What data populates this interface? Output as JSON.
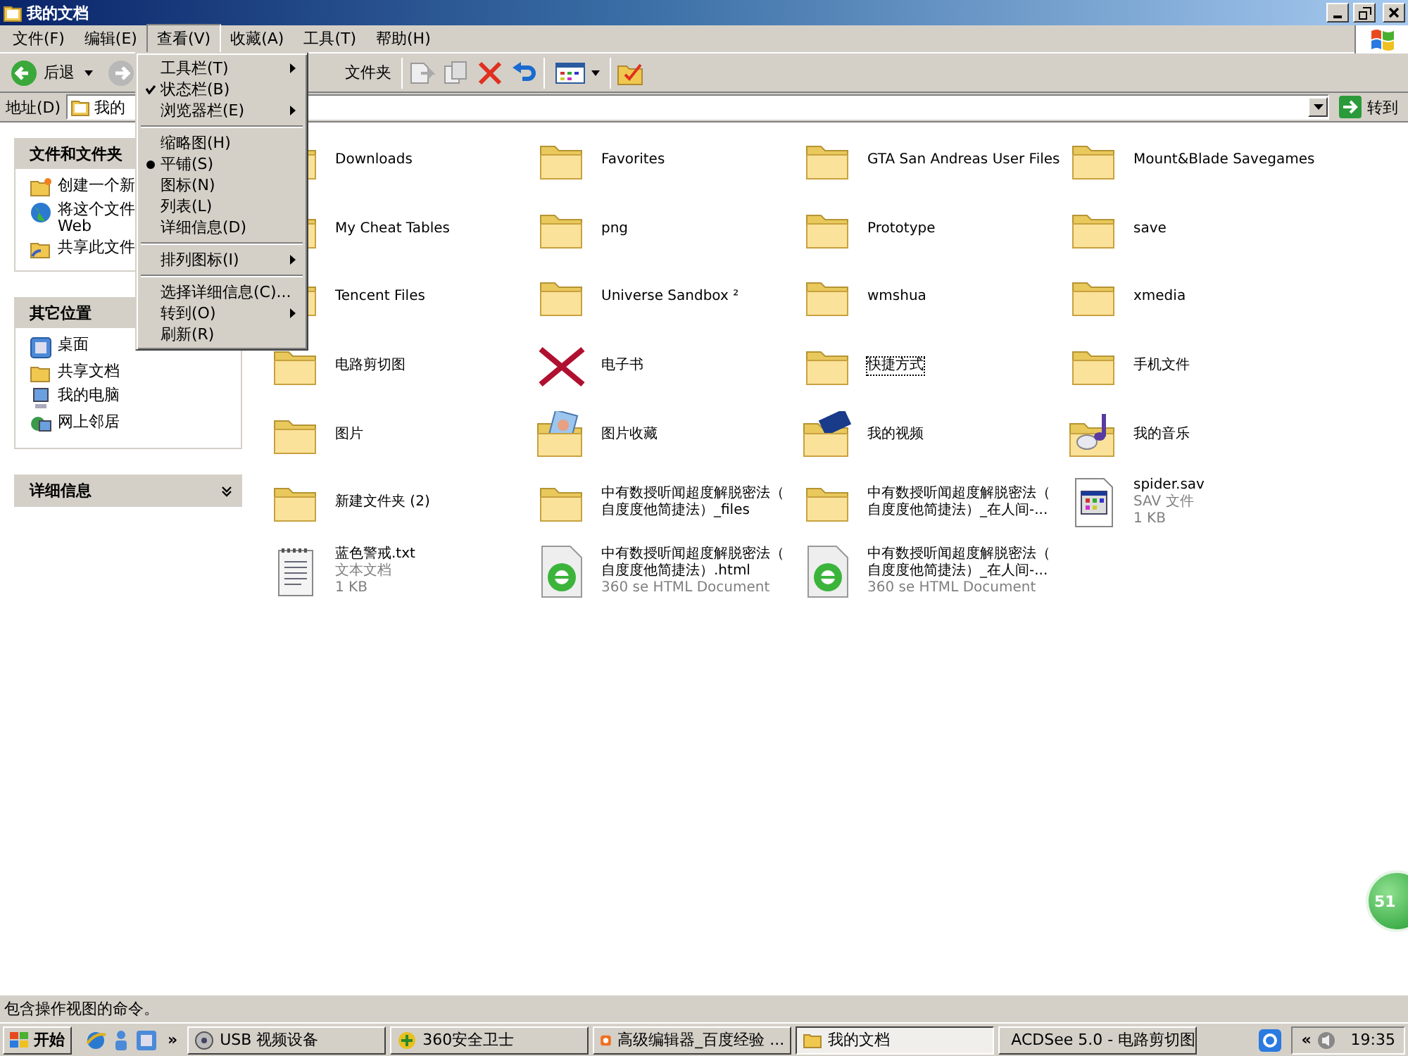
{
  "window": {
    "title": "我的文档"
  },
  "menu_bar": [
    {
      "label": "文件(F)",
      "selected": false
    },
    {
      "label": "编辑(E)",
      "selected": false
    },
    {
      "label": "查看(V)",
      "selected": true
    },
    {
      "label": "收藏(A)",
      "selected": false
    },
    {
      "label": "工具(T)",
      "selected": false
    },
    {
      "label": "帮助(H)",
      "selected": false
    }
  ],
  "toolbar": {
    "back": "后退",
    "folders": "文件夹"
  },
  "address_bar": {
    "label": "地址(D)",
    "value": "我的",
    "go": "转到"
  },
  "task_panes": [
    {
      "title": "文件和文件夹",
      "expanded": true,
      "items": [
        {
          "kind": "new-folder",
          "lines": [
            "创建一个新"
          ]
        },
        {
          "kind": "globe",
          "lines": [
            "将这个文件",
            "Web"
          ]
        },
        {
          "kind": "share",
          "lines": [
            "共享此文件"
          ]
        }
      ]
    },
    {
      "title": "其它位置",
      "expanded": true,
      "items": [
        {
          "kind": "desktop",
          "lines": [
            "桌面"
          ]
        },
        {
          "kind": "folder",
          "lines": [
            "共享文档"
          ]
        },
        {
          "kind": "computer",
          "lines": [
            "我的电脑"
          ]
        },
        {
          "kind": "network",
          "lines": [
            "网上邻居"
          ]
        }
      ]
    },
    {
      "title": "详细信息",
      "expanded": false
    }
  ],
  "view_menu": {
    "groups": [
      [
        {
          "kind": "submenu",
          "label": "工具栏(T)"
        },
        {
          "kind": "check",
          "label": "状态栏(B)",
          "checked": true
        },
        {
          "kind": "submenu",
          "label": "浏览器栏(E)"
        }
      ],
      [
        {
          "kind": "radio",
          "label": "缩略图(H)",
          "selected": false
        },
        {
          "kind": "radio",
          "label": "平铺(S)",
          "selected": true
        },
        {
          "kind": "radio",
          "label": "图标(N)",
          "selected": false
        },
        {
          "kind": "radio",
          "label": "列表(L)",
          "selected": false
        },
        {
          "kind": "radio",
          "label": "详细信息(D)",
          "selected": false
        }
      ],
      [
        {
          "kind": "submenu",
          "label": "排列图标(I)"
        }
      ],
      [
        {
          "kind": "command",
          "label": "选择详细信息(C)..."
        },
        {
          "kind": "submenu",
          "label": "转到(O)"
        },
        {
          "kind": "command",
          "label": "刷新(R)"
        }
      ]
    ]
  },
  "files": [
    {
      "kind": "folder",
      "lines": [
        "Downloads"
      ],
      "focused": false
    },
    {
      "kind": "folder",
      "lines": [
        "Favorites"
      ],
      "focused": false
    },
    {
      "kind": "folder",
      "lines": [
        "GTA San Andreas User Files"
      ],
      "focused": false
    },
    {
      "kind": "folder",
      "lines": [
        "Mount&Blade Savegames"
      ],
      "focused": false
    },
    {
      "kind": "folder",
      "lines": [
        "My Cheat Tables"
      ],
      "focused": false
    },
    {
      "kind": "folder",
      "lines": [
        "png"
      ],
      "focused": false
    },
    {
      "kind": "folder",
      "lines": [
        "Prototype"
      ],
      "focused": false
    },
    {
      "kind": "folder",
      "lines": [
        "save"
      ],
      "focused": false
    },
    {
      "kind": "folder",
      "lines": [
        "Tencent Files"
      ],
      "focused": false
    },
    {
      "kind": "folder",
      "lines": [
        "Universe Sandbox ²"
      ],
      "focused": false
    },
    {
      "kind": "folder",
      "lines": [
        "wmshua"
      ],
      "focused": false
    },
    {
      "kind": "folder",
      "lines": [
        "xmedia"
      ],
      "focused": false
    },
    {
      "kind": "folder",
      "lines": [
        "电路剪切图"
      ],
      "focused": false
    },
    {
      "kind": "cross",
      "lines": [
        "电子书"
      ],
      "focused": false
    },
    {
      "kind": "folder",
      "lines": [
        "快捷方式"
      ],
      "focused": true
    },
    {
      "kind": "folder",
      "lines": [
        "手机文件"
      ],
      "focused": false
    },
    {
      "kind": "folder",
      "lines": [
        "图片"
      ],
      "focused": false
    },
    {
      "kind": "pictures",
      "lines": [
        "图片收藏"
      ],
      "focused": false
    },
    {
      "kind": "video",
      "lines": [
        "我的视频"
      ],
      "focused": false
    },
    {
      "kind": "music",
      "lines": [
        "我的音乐"
      ],
      "focused": false
    },
    {
      "kind": "folder",
      "lines": [
        "新建文件夹 (2)"
      ],
      "focused": false
    },
    {
      "kind": "folder",
      "lines": [
        "中有数授听闻超度解脱密法（",
        "自度度他简捷法）_files"
      ],
      "focused": false
    },
    {
      "kind": "folder",
      "lines": [
        "中有数授听闻超度解脱密法（",
        "自度度他简捷法）_在人间-..."
      ],
      "focused": false
    },
    {
      "kind": "sav",
      "lines": [
        "spider.sav"
      ],
      "type": "SAV 文件",
      "size": "1 KB",
      "focused": false
    },
    {
      "kind": "text",
      "lines": [
        "蓝色警戒.txt"
      ],
      "type": "文本文档",
      "size": "1 KB",
      "focused": false
    },
    {
      "kind": "html",
      "lines": [
        "中有数授听闻超度解脱密法（",
        "自度度他简捷法）.html"
      ],
      "type": "360 se HTML Document",
      "focused": false
    },
    {
      "kind": "html",
      "lines": [
        "中有数授听闻超度解脱密法（",
        "自度度他简捷法）_在人间-..."
      ],
      "type": "360 se HTML Document",
      "focused": false
    }
  ],
  "status_bar": "包含操作视图的命令。",
  "floating_ball": "51",
  "taskbar": {
    "start": "开始",
    "more": "»",
    "tasks": [
      {
        "kind": "usb",
        "label": "USB 视频设备",
        "selected": false
      },
      {
        "kind": "shield",
        "label": "360安全卫士",
        "selected": false
      },
      {
        "kind": "editor",
        "label": "高级编辑器_百度经验 ...",
        "selected": false
      },
      {
        "kind": "folder",
        "label": "我的文档",
        "selected": true
      },
      {
        "kind": "viewer",
        "label": "ACDSee 5.0 - 电路剪切图",
        "selected": false
      }
    ],
    "tray_toggle": "«",
    "clock": "19:35"
  }
}
